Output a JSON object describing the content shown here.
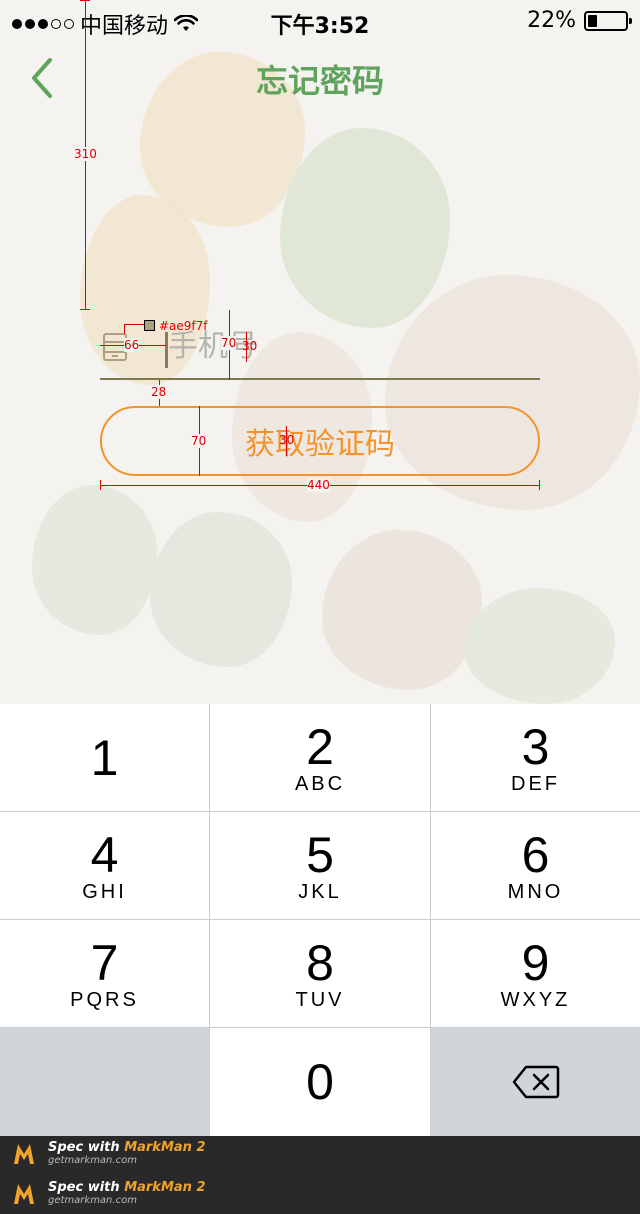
{
  "status_bar": {
    "carrier": "中国移动",
    "time": "下午3:52",
    "battery": "22%",
    "battery_level": 0.22,
    "signal_bars_filled": 3,
    "signal_bars_total": 5
  },
  "nav": {
    "title": "忘记密码",
    "back_icon": "chevron-left-icon"
  },
  "form": {
    "phone_placeholder": "手机号",
    "phone_value": "",
    "phone_icon": "phone-icon",
    "get_code_label": "获取验证码"
  },
  "annotations": {
    "top_margin": "310",
    "icon_gap": "66",
    "color_swatch": "#ae9f7f",
    "row_height": "70",
    "text_size": "30",
    "underline_gap": "28",
    "button_height": "70",
    "button_text_size": "30",
    "button_width": "440"
  },
  "keypad": {
    "keys": [
      {
        "num": "1",
        "letters": ""
      },
      {
        "num": "2",
        "letters": "ABC"
      },
      {
        "num": "3",
        "letters": "DEF"
      },
      {
        "num": "4",
        "letters": "GHI"
      },
      {
        "num": "5",
        "letters": "JKL"
      },
      {
        "num": "6",
        "letters": "MNO"
      },
      {
        "num": "7",
        "letters": "PQRS"
      },
      {
        "num": "8",
        "letters": "TUV"
      },
      {
        "num": "9",
        "letters": "WXYZ"
      },
      {
        "num": "0",
        "letters": ""
      }
    ],
    "delete_icon": "backspace-icon"
  },
  "watermark": {
    "prefix": "Spec with ",
    "brand": "MarkMan 2",
    "site": "getmarkman.com"
  },
  "colors": {
    "title_green": "#5fa35d",
    "accent_orange": "#f4932a",
    "annotation_red": "#dd0000",
    "keypad_bg": "#c9ccd2"
  }
}
